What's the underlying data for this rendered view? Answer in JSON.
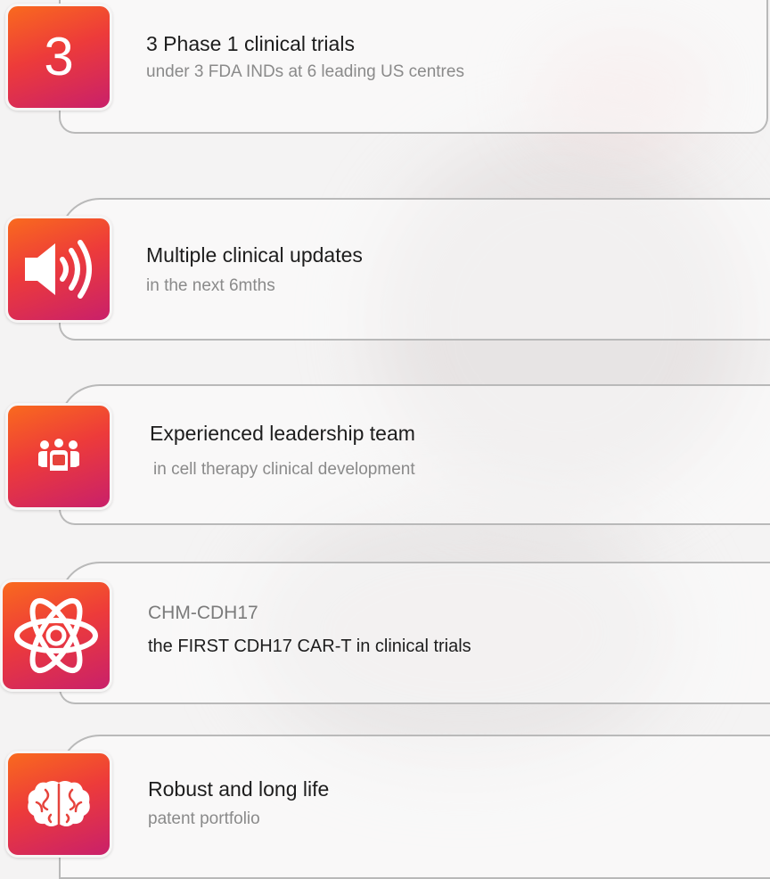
{
  "items": [
    {
      "badge_text": "3",
      "icon": "number-three-badge",
      "title": "3 Phase 1 clinical trials",
      "subtitle": "under 3 FDA INDs at 6 leading US centres"
    },
    {
      "icon": "speaker-icon",
      "title": "Multiple clinical updates",
      "subtitle": "in the next 6mths"
    },
    {
      "icon": "team-icon",
      "title": "Experienced leadership team",
      "subtitle": "in cell therapy clinical development"
    },
    {
      "icon": "atom-icon",
      "title": "CHM-CDH17",
      "subtitle": "the FIRST CDH17 CAR-T in clinical trials"
    },
    {
      "icon": "brain-icon",
      "title": "Robust and long life",
      "subtitle": "patent portfolio"
    }
  ],
  "colors": {
    "gradient_start": "#f96a1e",
    "gradient_mid": "#ed3b3a",
    "gradient_end": "#c9206a",
    "border": "#b9b9b9"
  }
}
